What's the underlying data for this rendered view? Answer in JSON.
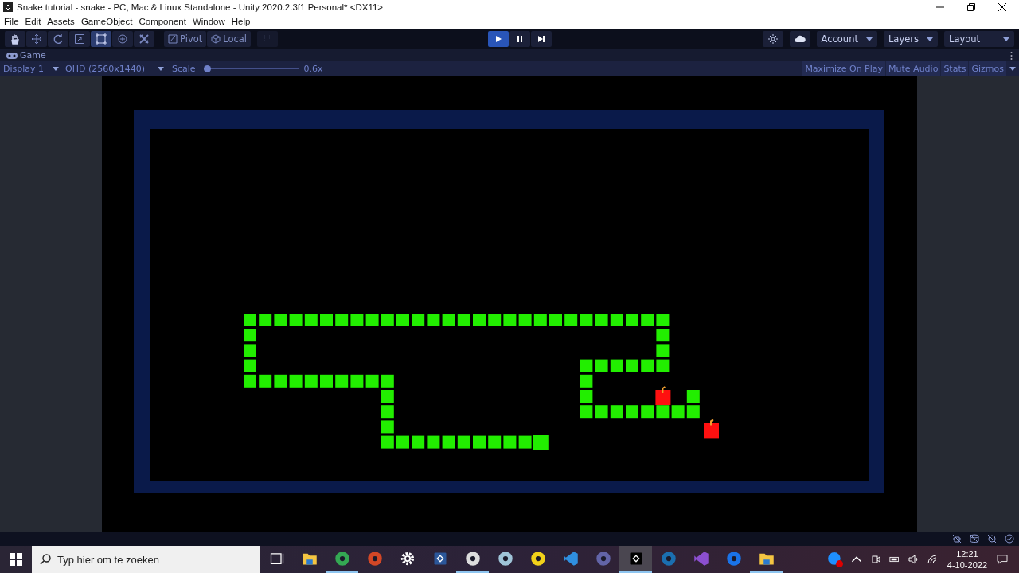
{
  "window": {
    "title": "Snake tutorial - snake - PC, Mac & Linux Standalone - Unity 2020.2.3f1 Personal* <DX11>"
  },
  "menu": [
    "File",
    "Edit",
    "Assets",
    "GameObject",
    "Component",
    "Window",
    "Help"
  ],
  "tools": [
    {
      "kind": "hand",
      "selected": false
    },
    {
      "kind": "move",
      "selected": false
    },
    {
      "kind": "rotate",
      "selected": false
    },
    {
      "kind": "scale",
      "selected": false
    },
    {
      "kind": "rect",
      "selected": true
    },
    {
      "kind": "transform",
      "selected": false
    },
    {
      "kind": "custom",
      "selected": false
    }
  ],
  "pivot": "Pivot",
  "local": "Local",
  "playback": [
    {
      "kind": "play",
      "selected": true
    },
    {
      "kind": "pause",
      "selected": false
    },
    {
      "kind": "step",
      "selected": false
    }
  ],
  "right_menus": [
    "Account",
    "Layers",
    "Layout"
  ],
  "game_tab": "Game",
  "game_toolbar": {
    "display": "Display 1",
    "resolution": "QHD (2560x1440)",
    "scale_label": "Scale",
    "scale": {
      "level": 0.0,
      "reading": "0.6x"
    },
    "toggles": [
      {
        "label": "Maximize On Play",
        "selected": false
      },
      {
        "label": "Mute Audio",
        "selected": false
      },
      {
        "label": "Stats",
        "selected": false
      },
      {
        "label": "Gizmos",
        "selected": false
      }
    ]
  },
  "taskbar": {
    "search": {
      "placeholder": "Typ hier om te zoeken"
    },
    "apps": [
      {
        "kind": "taskview",
        "open": false,
        "selected": false
      },
      {
        "kind": "folder",
        "open": false,
        "selected": false
      },
      {
        "kind": "chrome",
        "open": true,
        "selected": false
      },
      {
        "kind": "powerpoint",
        "open": false,
        "selected": false
      },
      {
        "kind": "settings",
        "open": false,
        "selected": false
      },
      {
        "kind": "word",
        "open": false,
        "selected": false
      },
      {
        "kind": "unityhub",
        "open": true,
        "selected": false
      },
      {
        "kind": "glass",
        "open": false,
        "selected": false
      },
      {
        "kind": "cursor",
        "open": false,
        "selected": false
      },
      {
        "kind": "vscode",
        "open": false,
        "selected": false
      },
      {
        "kind": "teams",
        "open": false,
        "selected": false
      },
      {
        "kind": "unity",
        "open": true,
        "selected": true
      },
      {
        "kind": "steam",
        "open": false,
        "selected": false
      },
      {
        "kind": "visualstudio",
        "open": false,
        "selected": false
      },
      {
        "kind": "maps",
        "open": false,
        "selected": false
      },
      {
        "kind": "folder",
        "open": true,
        "selected": false
      }
    ],
    "time": "12:21",
    "date": "4-10-2022"
  }
}
